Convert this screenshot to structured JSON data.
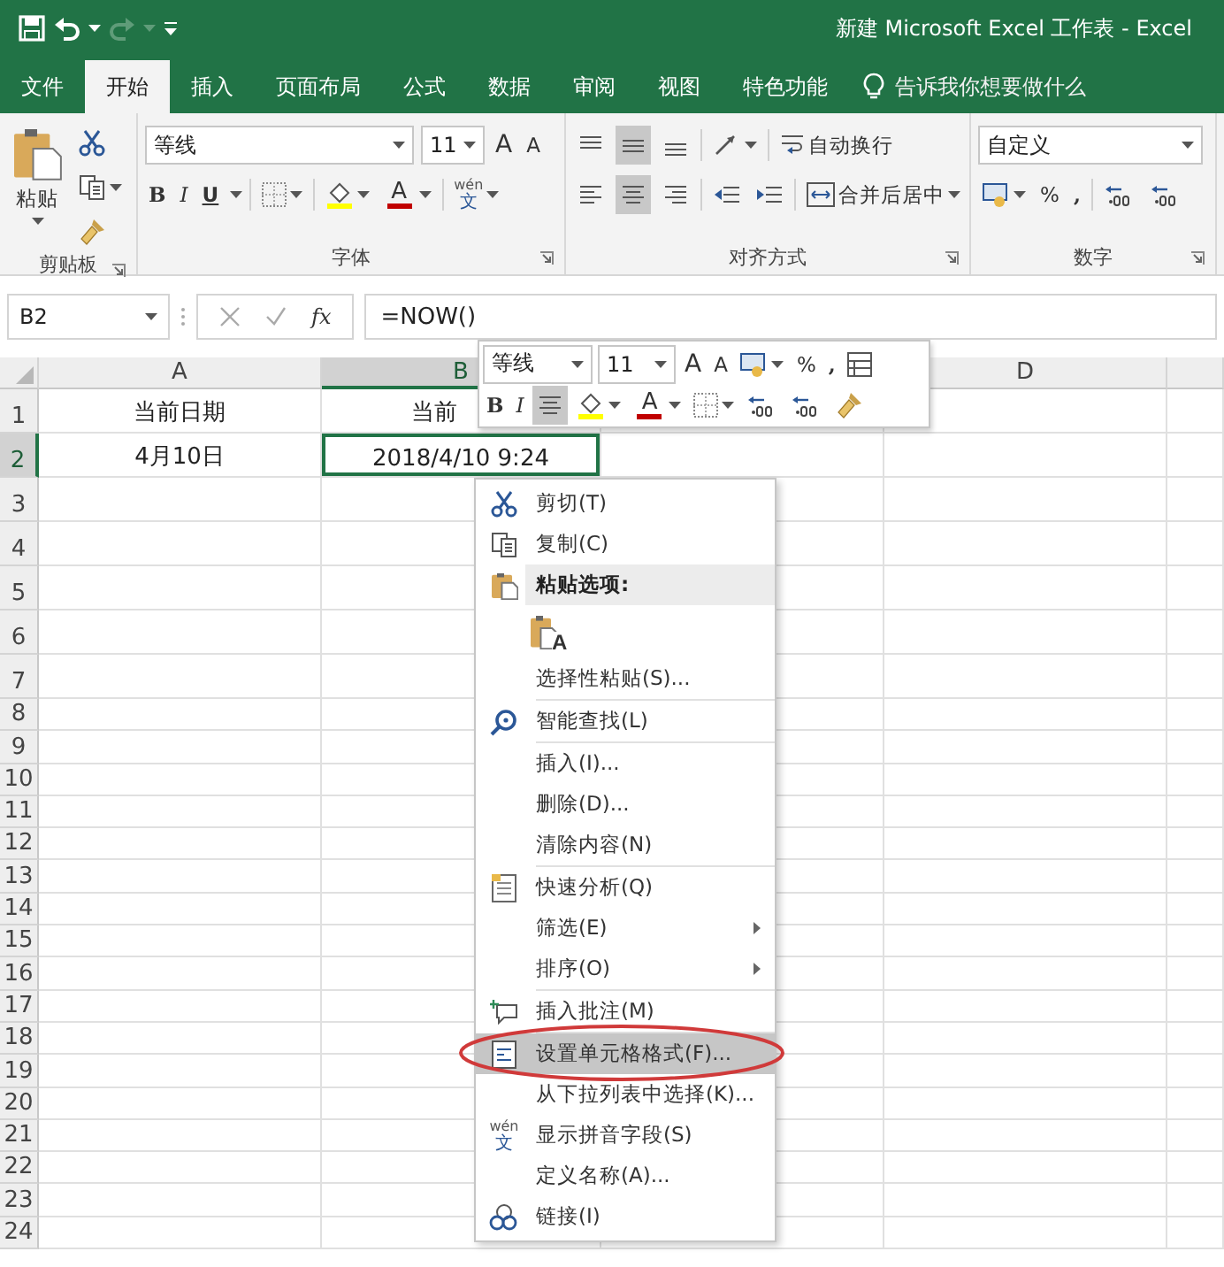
{
  "title_bar": {
    "title": "新建 Microsoft Excel 工作表 - Excel"
  },
  "tabs": [
    {
      "label": "文件",
      "selected": false
    },
    {
      "label": "开始",
      "selected": true
    },
    {
      "label": "插入",
      "selected": false
    },
    {
      "label": "页面布局",
      "selected": false
    },
    {
      "label": "公式",
      "selected": false
    },
    {
      "label": "数据",
      "selected": false
    },
    {
      "label": "审阅",
      "selected": false
    },
    {
      "label": "视图",
      "selected": false
    },
    {
      "label": "特色功能",
      "selected": false
    }
  ],
  "tell_me": {
    "placeholder": "告诉我你想要做什么"
  },
  "ribbon": {
    "clipboard": {
      "label": "剪贴板",
      "paste": "粘贴"
    },
    "font": {
      "label": "字体",
      "font": "等线",
      "size": "11",
      "grow": "A",
      "shrink": "A",
      "bold": "B",
      "italic": "I",
      "underline": "U",
      "font_color": "A",
      "pinyin": "wén",
      "char": "文"
    },
    "alignment": {
      "label": "对齐方式",
      "vertical": [
        {
          "selected": false
        },
        {
          "selected": true
        },
        {
          "selected": false
        }
      ],
      "horizontal": [
        {
          "selected": false
        },
        {
          "selected": true
        },
        {
          "selected": false
        }
      ],
      "wrap": "自动换行",
      "merge": "合并后居中"
    },
    "number": {
      "label": "数字",
      "format": "自定义",
      "percent": "%",
      "comma": ","
    }
  },
  "formula_bar": {
    "name_box": "B2",
    "fx": "fx",
    "formula": "=NOW()"
  },
  "sheet": {
    "columns": [
      {
        "label": "A",
        "selected": false
      },
      {
        "label": "B",
        "selected": true
      },
      {
        "label": "D",
        "selected": false
      }
    ],
    "rows": [
      {
        "label": "1",
        "selected": false,
        "cells": [
          {
            "text": "当前日期",
            "selected": false
          },
          {
            "text": "当前",
            "selected": false
          }
        ]
      },
      {
        "label": "2",
        "selected": true,
        "cells": [
          {
            "text": "4月10日",
            "selected": false
          },
          {
            "text": "2018/4/10 9:24",
            "selected": true
          }
        ]
      },
      {
        "label": "3",
        "selected": false
      },
      {
        "label": "4",
        "selected": false
      },
      {
        "label": "5",
        "selected": false
      },
      {
        "label": "6",
        "selected": false
      },
      {
        "label": "7",
        "selected": false
      },
      {
        "label": "8",
        "selected": false
      },
      {
        "label": "9",
        "selected": false
      },
      {
        "label": "10",
        "selected": false
      },
      {
        "label": "11",
        "selected": false
      },
      {
        "label": "12",
        "selected": false
      },
      {
        "label": "13",
        "selected": false
      },
      {
        "label": "14",
        "selected": false
      },
      {
        "label": "15",
        "selected": false
      },
      {
        "label": "16",
        "selected": false
      },
      {
        "label": "17",
        "selected": false
      },
      {
        "label": "18",
        "selected": false
      },
      {
        "label": "19",
        "selected": false
      },
      {
        "label": "20",
        "selected": false
      },
      {
        "label": "21",
        "selected": false
      },
      {
        "label": "22",
        "selected": false
      },
      {
        "label": "23",
        "selected": false
      },
      {
        "label": "24",
        "selected": false
      }
    ]
  },
  "mini_toolbar": {
    "font": "等线",
    "size": "11",
    "grow": "A",
    "shrink": "A",
    "percent": "%",
    "comma": ",",
    "bold": "B",
    "italic": "I",
    "center_selected": true,
    "font_color": "A"
  },
  "context_menu": {
    "items": [
      {
        "kind": "item",
        "label": "剪切(T)",
        "separator_before": false,
        "submenu": false,
        "selected": false,
        "circled": false
      },
      {
        "kind": "item",
        "label": "复制(C)",
        "separator_before": false,
        "submenu": false,
        "selected": false,
        "circled": false
      },
      {
        "kind": "header",
        "label": "粘贴选项:"
      },
      {
        "kind": "paste-options",
        "letter": "A"
      },
      {
        "kind": "item",
        "label": "选择性粘贴(S)...",
        "separator_before": false,
        "submenu": false,
        "selected": false,
        "circled": false
      },
      {
        "kind": "item",
        "label": "智能查找(L)",
        "separator_before": true,
        "submenu": false,
        "selected": false,
        "circled": false
      },
      {
        "kind": "item",
        "label": "插入(I)...",
        "separator_before": true,
        "submenu": false,
        "selected": false,
        "circled": false
      },
      {
        "kind": "item",
        "label": "删除(D)...",
        "separator_before": false,
        "submenu": false,
        "selected": false,
        "circled": false
      },
      {
        "kind": "item",
        "label": "清除内容(N)",
        "separator_before": false,
        "submenu": false,
        "selected": false,
        "circled": false
      },
      {
        "kind": "item",
        "label": "快速分析(Q)",
        "separator_before": true,
        "submenu": false,
        "selected": false,
        "circled": false
      },
      {
        "kind": "item",
        "label": "筛选(E)",
        "separator_before": false,
        "submenu": true,
        "selected": false,
        "circled": false
      },
      {
        "kind": "item",
        "label": "排序(O)",
        "separator_before": false,
        "submenu": true,
        "selected": false,
        "circled": false
      },
      {
        "kind": "item",
        "label": "插入批注(M)",
        "separator_before": true,
        "submenu": false,
        "selected": false,
        "circled": false
      },
      {
        "kind": "item",
        "label": "设置单元格格式(F)...",
        "separator_before": true,
        "submenu": false,
        "selected": true,
        "circled": true
      },
      {
        "kind": "item",
        "label": "从下拉列表中选择(K)...",
        "separator_before": false,
        "submenu": false,
        "selected": false,
        "circled": false
      },
      {
        "kind": "item",
        "label": "显示拼音字段(S)",
        "separator_before": false,
        "submenu": false,
        "selected": false,
        "circled": false,
        "pinyin": "wén",
        "char": "文"
      },
      {
        "kind": "item",
        "label": "定义名称(A)...",
        "separator_before": false,
        "submenu": false,
        "selected": false,
        "circled": false
      },
      {
        "kind": "item",
        "label": "链接(I)",
        "separator_before": false,
        "submenu": false,
        "selected": false,
        "circled": false
      }
    ]
  }
}
